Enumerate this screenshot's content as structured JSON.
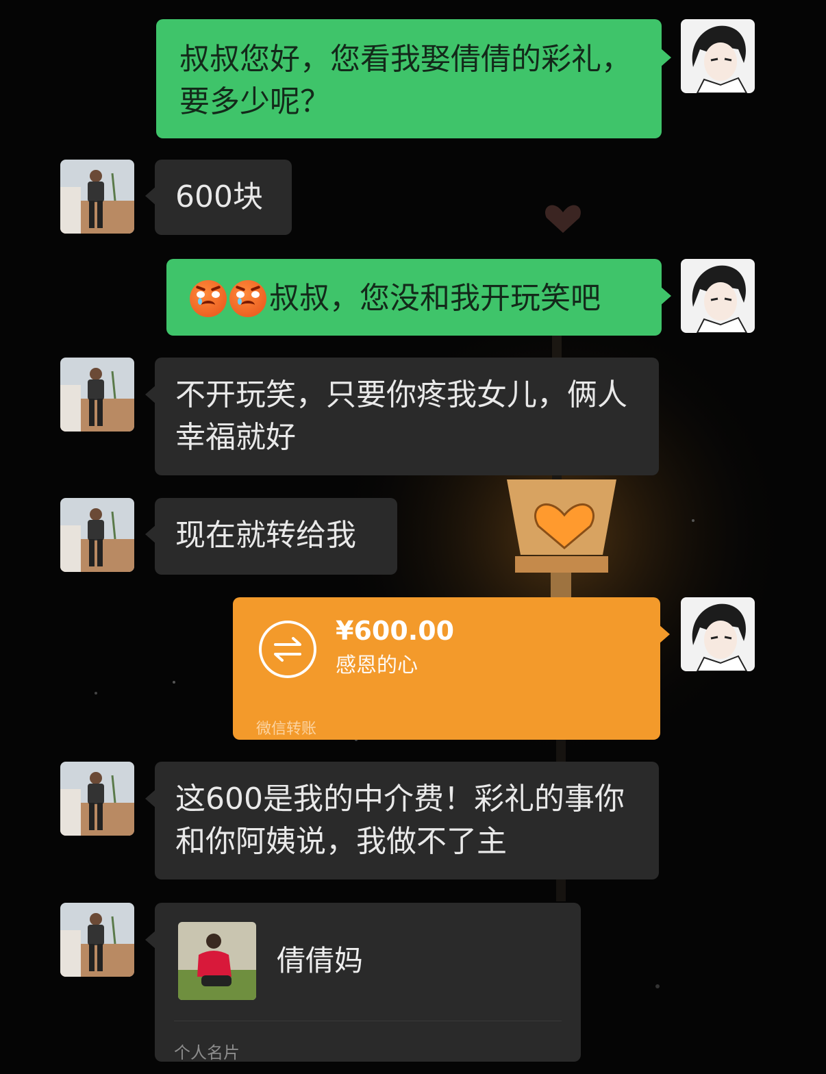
{
  "messages": {
    "m1": "叔叔您好，您看我娶倩倩的彩礼，要多少呢？",
    "m2": "600块",
    "m3": "叔叔，您没和我开玩笑吧",
    "m4": "不开玩笑，只要你疼我女儿，俩人幸福就好",
    "m5": "现在就转给我",
    "m7": "这600是我的中介费！彩礼的事你和你阿姨说，我做不了主"
  },
  "transfer": {
    "amount": "¥600.00",
    "note": "感恩的心",
    "type_label": "微信转账"
  },
  "contact_card": {
    "name": "倩倩妈",
    "type_label": "个人名片"
  },
  "colors": {
    "background": "#050505",
    "my_bubble": "#3fc46a",
    "their_bubble": "#2a2a2a",
    "transfer_bubble": "#f39a2b"
  },
  "icons": {
    "transfer": "transfer-arrows-icon",
    "emoji": "angry-crying-face-emoji"
  }
}
